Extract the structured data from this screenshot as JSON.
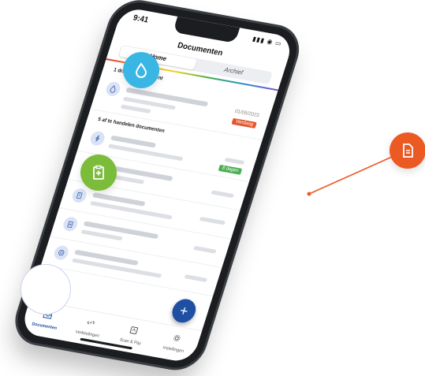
{
  "status": {
    "time": "9:41",
    "icons": "▮▮▮ ◉ ▭"
  },
  "header": {
    "title": "Documenten"
  },
  "tabs": [
    {
      "label": "Home",
      "active": true
    },
    {
      "label": "Archief",
      "active": false
    }
  ],
  "sections": {
    "urgent": "1 dringend document",
    "todo": "5 af te handelen documenten"
  },
  "urgent_item": {
    "date": "01/05/2023",
    "badge": "Vandaag"
  },
  "todo_badge": "8 dagen",
  "bottom_nav": [
    {
      "label": "Documenten",
      "icon": "inbox-icon",
      "active": true
    },
    {
      "label": "Verbindingen",
      "icon": "link-icon",
      "active": false
    },
    {
      "label": "Scan & Pay",
      "icon": "scan-icon",
      "active": false
    },
    {
      "label": "Instellingen",
      "icon": "gear-icon",
      "active": false
    }
  ],
  "fab": {
    "label": "+"
  },
  "callouts": [
    {
      "icon": "droplet-icon",
      "color": "#39b6e3"
    },
    {
      "icon": "clipboard-medical-icon",
      "color": "#7bbd3b"
    },
    {
      "icon": "document-icon",
      "color": "#ec5a24"
    }
  ],
  "colors": {
    "primary": "#1f4fa3",
    "urgent": "#e4572e",
    "ok": "#4caf50"
  }
}
